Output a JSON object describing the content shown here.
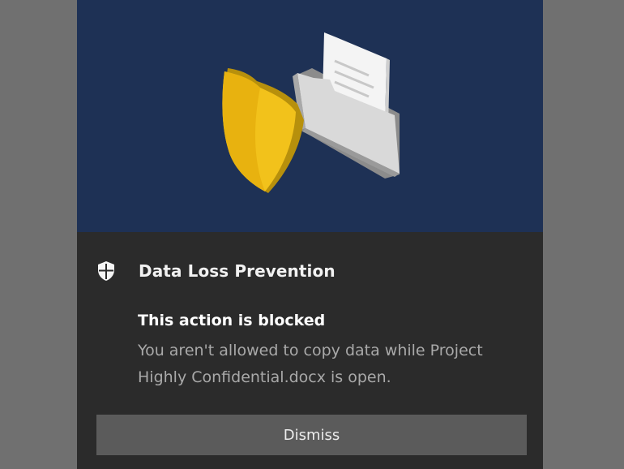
{
  "notification": {
    "app_name": "Data Loss Prevention",
    "app_icon": "shield-icon",
    "title": "This action is blocked",
    "message": "You aren't allowed to copy data while Project Highly Confidential.docx is open.",
    "dismiss_label": "Dismiss",
    "hero_illustration": "shield-and-folder-illustration"
  },
  "colors": {
    "hero_background": "#1e3155",
    "toast_background": "#2b2b2b",
    "button_background": "#5b5b5b",
    "shield_yellow": "#f2c21b"
  }
}
